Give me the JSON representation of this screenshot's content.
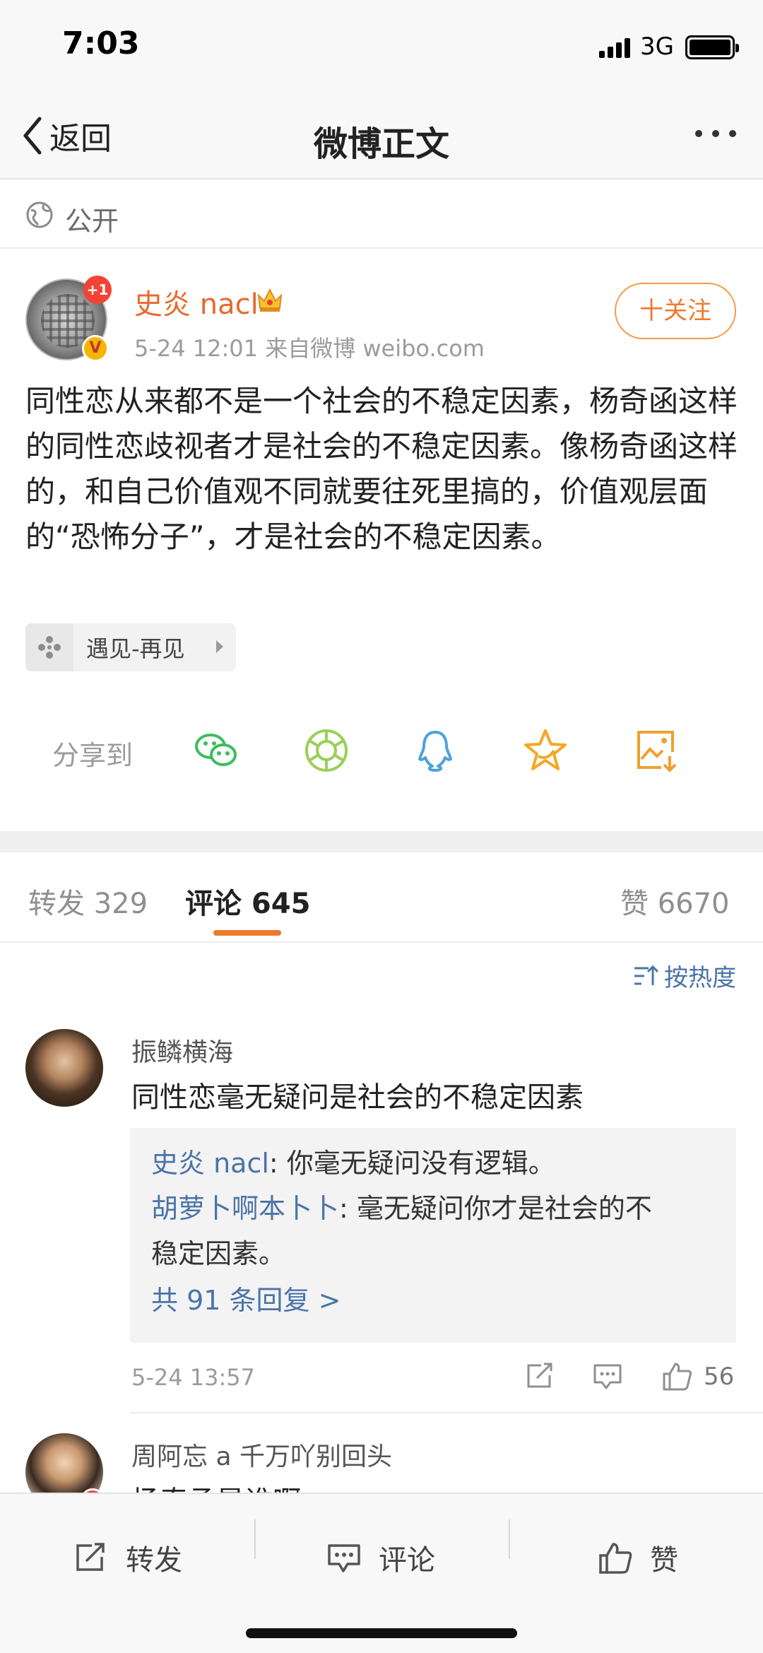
{
  "status_bar": {
    "time": "7:03",
    "network": "3G"
  },
  "nav": {
    "back_label": "返回",
    "title": "微博正文"
  },
  "visibility": {
    "label": "公开"
  },
  "post": {
    "author": "史炎 nacl",
    "notification_badge": "+1",
    "verified_mark": "V",
    "meta": "5-24 12:01  来自微博 weibo.com",
    "follow_label": "十关注",
    "text": "同性恋从来都不是一个社会的不稳定因素，杨奇函这样的同性恋歧视者才是社会的不稳定因素。像杨奇函这样的，和自己价值观不同就要往死里搞的，价值观层面的“恐怖分子”，才是社会的不稳定因素。",
    "topic": "遇见-再见",
    "share_label": "分享到",
    "share_targets": [
      "wechat-icon",
      "moments-icon",
      "qq-icon",
      "favorite-star-icon",
      "save-image-icon"
    ]
  },
  "tabs": {
    "reposts": "转发 329",
    "comments": "评论 645",
    "likes": "赞 6670"
  },
  "sort_label": "按热度",
  "comments": [
    {
      "user": "振鳞横海",
      "text": "同性恋毫无疑问是社会的不稳定因素",
      "replies": [
        {
          "author": "史炎 nacl",
          "text": ": 你毫无疑问没有逻辑。"
        },
        {
          "author": "胡萝卜啊本卜卜",
          "text": ": 毫无疑问你才是社会的不",
          "text_cont": "稳定因素。"
        }
      ],
      "more_replies": "共 91 条回复 >",
      "time": "5-24 13:57",
      "likes": "56"
    },
    {
      "user": "周阿忘 a 千万吖别回头",
      "text": "杨奇函是谁啊"
    }
  ],
  "bottom_bar": {
    "repost": "转发",
    "comment": "评论",
    "like": "赞"
  },
  "colors": {
    "accent_orange": "#f07a2a",
    "link_blue": "#4a74a8",
    "author_orange": "#e8692b"
  }
}
